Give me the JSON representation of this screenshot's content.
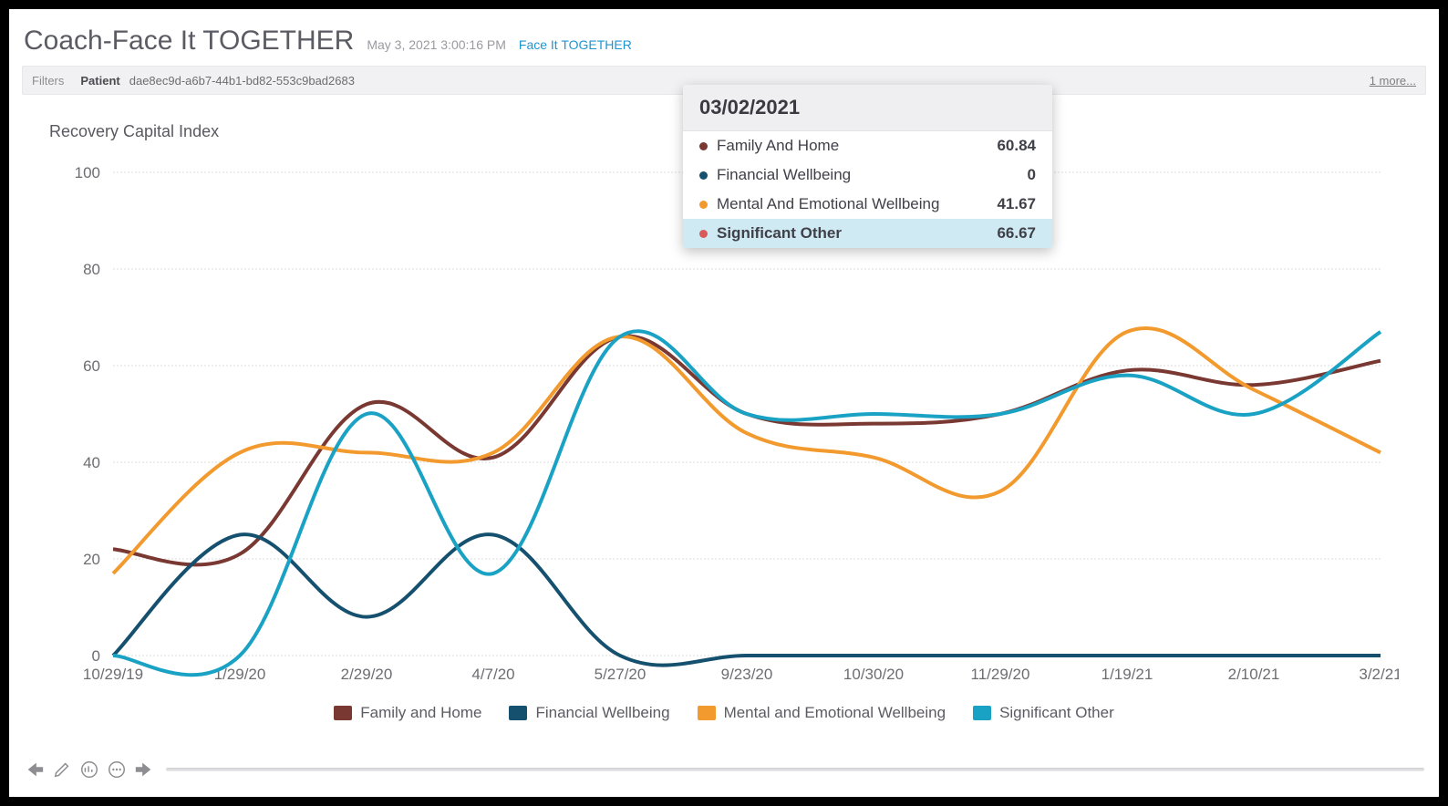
{
  "header": {
    "title": "Coach-Face It TOGETHER",
    "timestamp": "May 3, 2021 3:00:16 PM",
    "org_link": "Face It TOGETHER"
  },
  "filterbar": {
    "label": "Filters",
    "key": "Patient",
    "value": "dae8ec9d-a6b7-44b1-bd82-553c9bad2683",
    "more": "1 more..."
  },
  "chart_title": "Recovery Capital Index",
  "tooltip": {
    "date": "03/02/2021",
    "rows": [
      {
        "label": "Family And Home",
        "value": "60.84",
        "color": "#7a3832"
      },
      {
        "label": "Financial Wellbeing",
        "value": "0",
        "color": "#15506e"
      },
      {
        "label": "Mental And Emotional Wellbeing",
        "value": "41.67",
        "color": "#f29a2e"
      },
      {
        "label": "Significant Other",
        "value": "66.67",
        "color": "#d85a5a",
        "highlight": true
      }
    ]
  },
  "legend": [
    {
      "label": "Family and Home",
      "color": "#7a3832"
    },
    {
      "label": "Financial Wellbeing",
      "color": "#15506e"
    },
    {
      "label": "Mental and Emotional Wellbeing",
      "color": "#f29a2e"
    },
    {
      "label": "Significant Other",
      "color": "#1aa2c4"
    }
  ],
  "chart_data": {
    "type": "line",
    "title": "Recovery Capital Index",
    "ylabel": "",
    "xlabel": "",
    "ylim": [
      0,
      100
    ],
    "y_ticks": [
      0,
      20,
      40,
      60,
      80,
      100
    ],
    "categories": [
      "10/29/19",
      "1/29/20",
      "2/29/20",
      "4/7/20",
      "5/27/20",
      "9/23/20",
      "10/30/20",
      "11/29/20",
      "1/19/21",
      "2/10/21",
      "3/2/21"
    ],
    "series": [
      {
        "name": "Family and Home",
        "color": "#7a3832",
        "values": [
          22,
          21,
          52,
          41,
          66,
          50,
          48,
          50,
          59,
          56,
          61
        ]
      },
      {
        "name": "Financial Wellbeing",
        "color": "#15506e",
        "values": [
          0,
          25,
          8,
          25,
          0,
          0,
          0,
          0,
          0,
          0,
          0
        ]
      },
      {
        "name": "Mental and Emotional Wellbeing",
        "color": "#f29a2e",
        "values": [
          17,
          42,
          42,
          42,
          66,
          46,
          41,
          34,
          67,
          55,
          42
        ]
      },
      {
        "name": "Significant Other",
        "color": "#1aa2c4",
        "values": [
          0,
          0,
          50,
          17,
          66,
          50,
          50,
          50,
          58,
          50,
          67
        ]
      }
    ]
  }
}
